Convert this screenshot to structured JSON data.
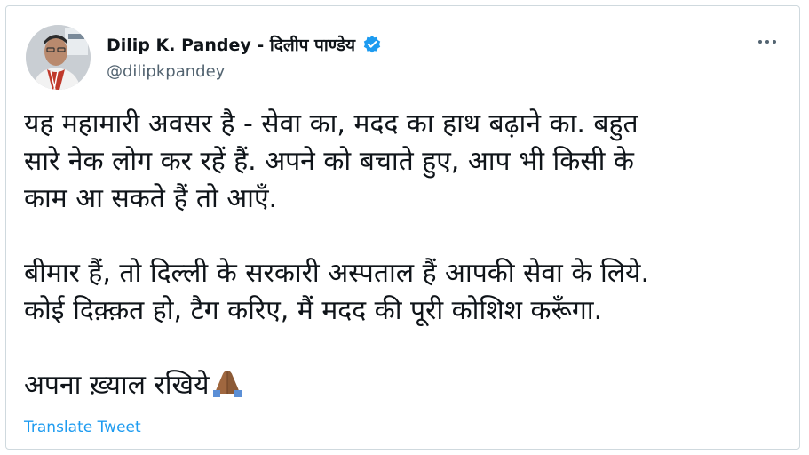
{
  "tweet": {
    "author": {
      "display_name": "Dilip K. Pandey - दिलीप पाण्डेय",
      "handle": "@dilipkpandey",
      "verified_icon": "verified-badge-icon",
      "avatar_icon": "profile-photo"
    },
    "more_icon": "more-options-icon",
    "lines_para1": [
      "यह महामारी अवसर है - सेवा का, मदद का हाथ बढ़ाने का. बहुत",
      "सारे नेक लोग कर रहें हैं. अपने को बचाते हुए, आप भी किसी के",
      "काम आ सकते हैं तो आएँ."
    ],
    "lines_para2": [
      "बीमार हैं, तो दिल्ली के सरकारी अस्पताल हैं आपकी सेवा के लिये.",
      "कोई दिक़्क़त हो, टैग करिए, मैं मदद की पूरी कोशिश करूँगा."
    ],
    "line_para3": "अपना ख़्याल रखिये",
    "emoji": "folded-hands-icon",
    "translate_label": "Translate Tweet"
  },
  "colors": {
    "link": "#1d9bf0",
    "verified": "#1d9bf0",
    "secondary_text": "#536471",
    "border": "#cfd9de"
  }
}
